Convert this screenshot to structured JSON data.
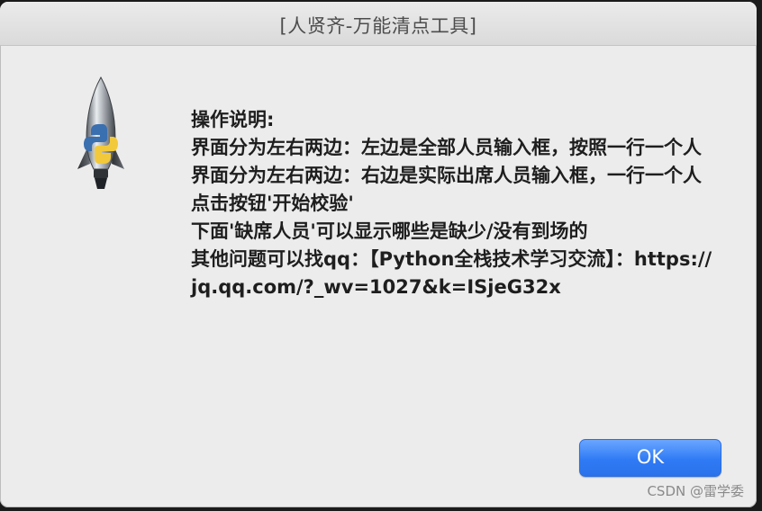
{
  "window": {
    "title": "[人贤齐-万能清点工具]"
  },
  "dialog": {
    "icon": "python-rocket-icon",
    "message": "操作说明:\n界面分为左右两边：左边是全部人员输入框，按照一行一个人\n界面分为左右两边：右边是实际出席人员输入框，一行一个人\n点击按钮'开始校验'\n下面'缺席人员'可以显示哪些是缺少/没有到场的\n其他问题可以找qq：【Python全栈技术学习交流】：https://jq.qq.com/?_wv=1027&k=ISjeG32x",
    "ok_label": "OK"
  },
  "watermark": {
    "text": "CSDN @雷学委"
  },
  "colors": {
    "accent": "#2f7bf5",
    "window_bg": "#ececec",
    "text": "#1e1e1e"
  }
}
